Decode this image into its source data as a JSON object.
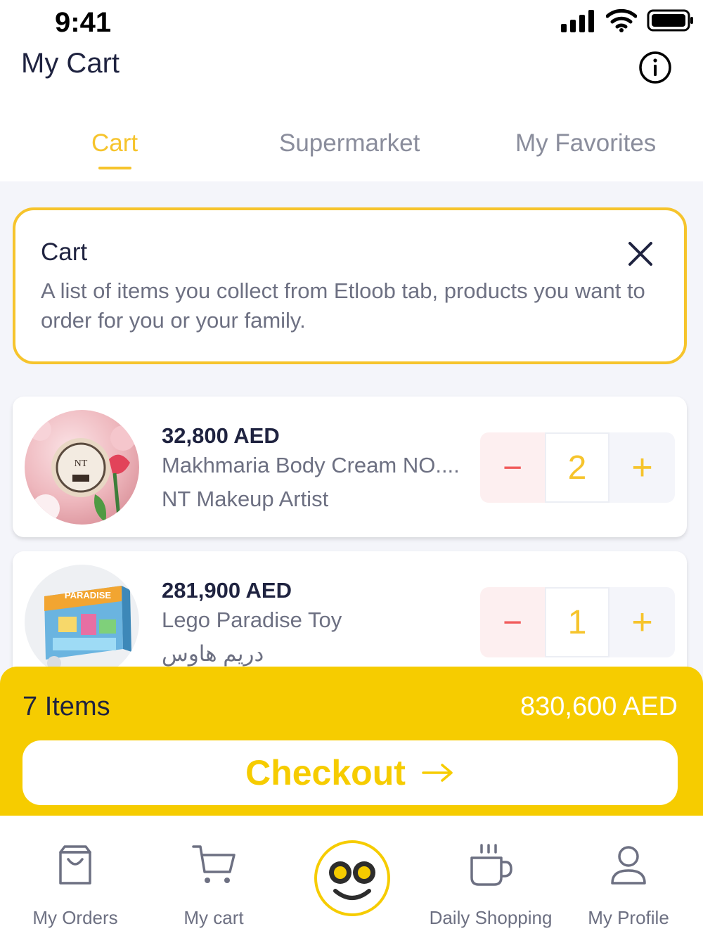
{
  "status_bar": {
    "time": "9:41"
  },
  "header": {
    "title": "My Cart"
  },
  "tabs": [
    {
      "label": "Cart",
      "active": true
    },
    {
      "label": "Supermarket",
      "active": false
    },
    {
      "label": "My Favorites",
      "active": false
    }
  ],
  "info_card": {
    "title": "Cart",
    "description": "A list of items you collect from Etloob tab, products you want to order for you or your family."
  },
  "items": [
    {
      "price": "32,800 AED",
      "name": "Makhmaria Body Cream NO....",
      "seller": "NT Makeup Artist",
      "quantity": "2",
      "minus": "−",
      "plus": "+"
    },
    {
      "price": "281,900 AED",
      "name": "Lego Paradise Toy",
      "seller": "دريم هاوس",
      "quantity": "1",
      "minus": "−",
      "plus": "+"
    }
  ],
  "summary": {
    "count": "7 Items",
    "total": "830,600 AED",
    "checkout": "Checkout"
  },
  "nav": {
    "orders": "My Orders",
    "cart": "My cart",
    "daily": "Daily Shopping",
    "profile": "My Profile"
  },
  "colors": {
    "accent": "#f6c42c",
    "summary_bg": "#f6cc00",
    "minus": "#f15b5b"
  }
}
